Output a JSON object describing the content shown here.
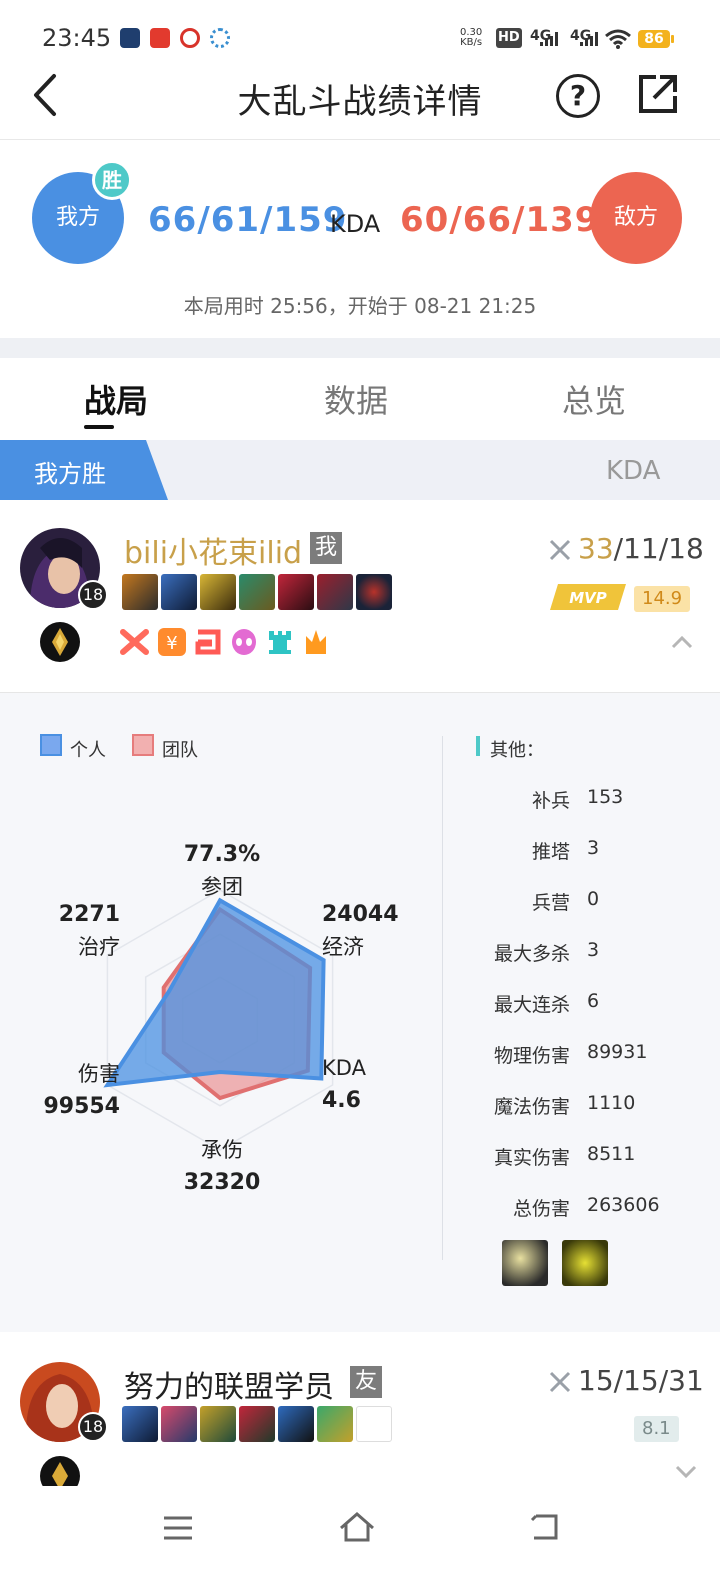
{
  "status_bar": {
    "time": "23:45",
    "net_speed_value": "0.30",
    "net_speed_unit": "KB/s",
    "hd_label": "HD",
    "sim1": "4G",
    "sim2": "4G",
    "battery": "86"
  },
  "nav": {
    "title": "大乱斗战绩详情",
    "help_icon": "?",
    "back_icon": "back-arrow-icon",
    "share_icon": "share-external-icon"
  },
  "summary": {
    "my_team_label": "我方",
    "win_badge": "胜",
    "my_kda": "66/61/159",
    "kda_label": "KDA",
    "enemy_kda": "60/66/139",
    "enemy_team_label": "敌方",
    "duration": "本局用时 25:56，开始于 08-21 21:25",
    "colors": {
      "my_team": "#4a90e2",
      "enemy_team": "#ec6551"
    }
  },
  "tabs": [
    {
      "label": "战局",
      "active": true
    },
    {
      "label": "数据",
      "active": false
    },
    {
      "label": "总览",
      "active": false
    }
  ],
  "result": {
    "label": "我方胜",
    "kda_column": "KDA"
  },
  "player1": {
    "name": "bili小花束ilid",
    "tag": "我",
    "level": "18",
    "kda": "33/11/18",
    "kda_highlight": "33",
    "kda_rest": "/11/18",
    "mvp_label": "MVP",
    "score": "14.9"
  },
  "stats_panel": {
    "legend": {
      "personal": "个人",
      "team": "团队"
    },
    "radar": {
      "participation": {
        "value": "77.3%",
        "label": "参团"
      },
      "economy": {
        "value": "24044",
        "label": "经济"
      },
      "kda": {
        "label": "KDA",
        "value": "4.6"
      },
      "taken": {
        "label": "承伤",
        "value": "32320"
      },
      "damage": {
        "label": "伤害",
        "value": "99554"
      },
      "healing": {
        "value": "2271",
        "label": "治疗"
      },
      "personal_levels": [
        0.92,
        0.92,
        0.9,
        0.4,
        1.0,
        0.45
      ],
      "team_levels": [
        0.85,
        0.8,
        0.78,
        0.6,
        0.5,
        0.5
      ]
    },
    "other_title": "其他：",
    "others": [
      {
        "label": "补兵",
        "value": "153"
      },
      {
        "label": "推塔",
        "value": "3"
      },
      {
        "label": "兵营",
        "value": "0"
      },
      {
        "label": "最大多杀",
        "value": "3"
      },
      {
        "label": "最大连杀",
        "value": "6"
      },
      {
        "label": "物理伤害",
        "value": "89931"
      },
      {
        "label": "魔法伤害",
        "value": "1110"
      },
      {
        "label": "真实伤害",
        "value": "8511"
      },
      {
        "label": "总伤害",
        "value": "263606"
      }
    ]
  },
  "player2": {
    "name": "努力的联盟学员",
    "tag": "友",
    "level": "18",
    "kda": "15/15/31",
    "score": "8.1"
  }
}
